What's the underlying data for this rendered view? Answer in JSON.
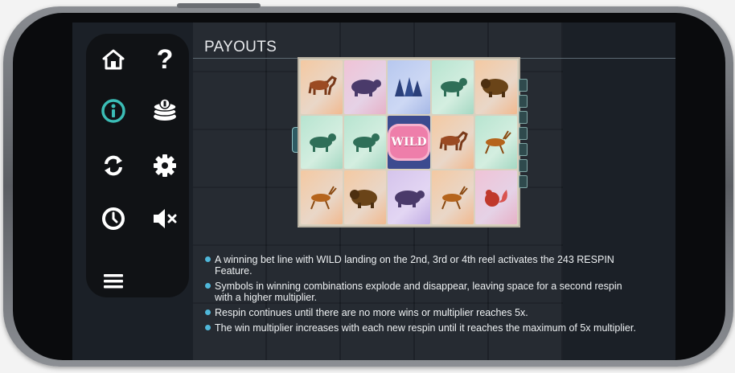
{
  "page": {
    "title": "PAYOUTS"
  },
  "menu": {
    "home": "home-icon",
    "help": "?",
    "info": "info-icon",
    "coins": "coins-icon",
    "autoplay": "refresh-icon",
    "settings": "gear-icon",
    "history": "clock-icon",
    "sound": "speaker-muted-icon",
    "more": "hamburger-menu-icon"
  },
  "reels": {
    "grid": [
      [
        "moose",
        "bear",
        "wolves",
        "lynx",
        "bison"
      ],
      [
        "lynx",
        "lynx",
        "WILD",
        "moose",
        "antelope"
      ],
      [
        "antelope",
        "bison",
        "bear",
        "antelope",
        "squirrel"
      ]
    ],
    "wild_label": "WILD"
  },
  "rules": [
    "A winning bet line with WILD landing on the 2nd, 3rd or 4th reel activates the 243 RESPIN Feature.",
    "Symbols in winning combinations explode and disappear, leaving space for a second respin with a higher multiplier.",
    "Respin continues until there are no more wins or multiplier reaches 5x.",
    "The win multiplier increases with each new respin until it reaches the maximum of 5x multiplier."
  ],
  "colors": {
    "accent": "#3bbdb6",
    "bullet": "#4fb7d9",
    "wild": "#ee7eaa"
  }
}
